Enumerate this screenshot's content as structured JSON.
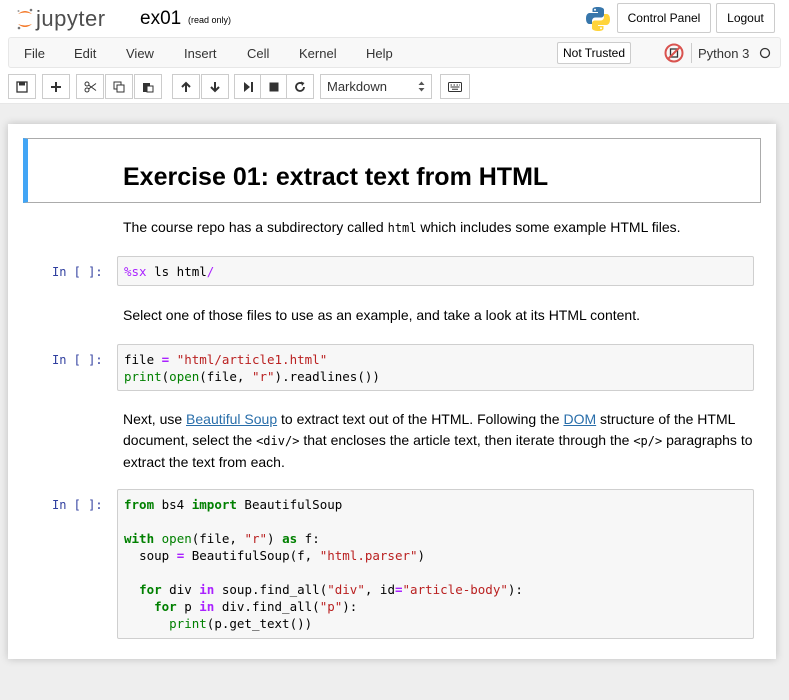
{
  "header": {
    "logo_text": "jupyter",
    "notebook_name": "ex01",
    "read_only": "(read only)",
    "control_panel": "Control Panel",
    "logout": "Logout"
  },
  "menu": {
    "items": [
      "File",
      "Edit",
      "View",
      "Insert",
      "Cell",
      "Kernel",
      "Help"
    ],
    "not_trusted": "Not Trusted",
    "kernel_name": "Python 3"
  },
  "toolbar": {
    "cell_type": "Markdown"
  },
  "cells": {
    "heading": "Exercise 01: extract text from HTML",
    "md1_pre": "The course repo has a subdirectory called ",
    "md1_code": "html",
    "md1_post": " which includes some example HTML files.",
    "prompt": "In [ ]:",
    "code1_magic": "%sx",
    "code1_rest": " ls html",
    "code1_slash": "/",
    "md2": "Select one of those files to use as an example, and take a look at its HTML content.",
    "code2": {
      "l1_a": "file ",
      "l1_eq": "=",
      "l1_b": " ",
      "l1_str": "\"html/article1.html\"",
      "l2_print": "print",
      "l2_a": "(",
      "l2_open": "open",
      "l2_b": "(file, ",
      "l2_str": "\"r\"",
      "l2_c": ").readlines())"
    },
    "md3": {
      "p1": "Next, use ",
      "link1": "Beautiful Soup",
      "p2": " to extract text out of the HTML. Following the ",
      "link2": "DOM",
      "p3": " structure of the HTML document, select the ",
      "code_a": "<div/>",
      "p4": " that encloses the article text, then iterate through the ",
      "code_b": "<p/>",
      "p5": " paragraphs to extract the text from each."
    },
    "code3": {
      "from": "from",
      "mod": " bs4 ",
      "import": "import",
      "cls": " BeautifulSoup",
      "with": "with",
      "open": "open",
      "a1": "(file, ",
      "r": "\"r\"",
      "a2": ") ",
      "as": "as",
      "a3": " f:",
      "soup_a": "soup ",
      "soup_b": " BeautifulSoup(f, ",
      "parser": "\"html.parser\"",
      "soup_c": ")",
      "for": "for",
      "div_a": " div ",
      "in": "in",
      "div_b": " soup.find_all(",
      "div_str": "\"div\"",
      "div_c": ", id",
      "div_id": "\"article-body\"",
      "div_d": "):",
      "p_a": " p ",
      "p_b": " div.find_all(",
      "p_str": "\"p\"",
      "p_c": "):",
      "print": "print",
      "print_rest": "(p.get_text())",
      "eq": "="
    }
  },
  "colors": {
    "prompt": "#303F9F",
    "keyword": "#008000",
    "string": "#BA2121",
    "magic": "#AA22FF",
    "link": "#296eaa",
    "selected_cell": "#42A5F5"
  }
}
